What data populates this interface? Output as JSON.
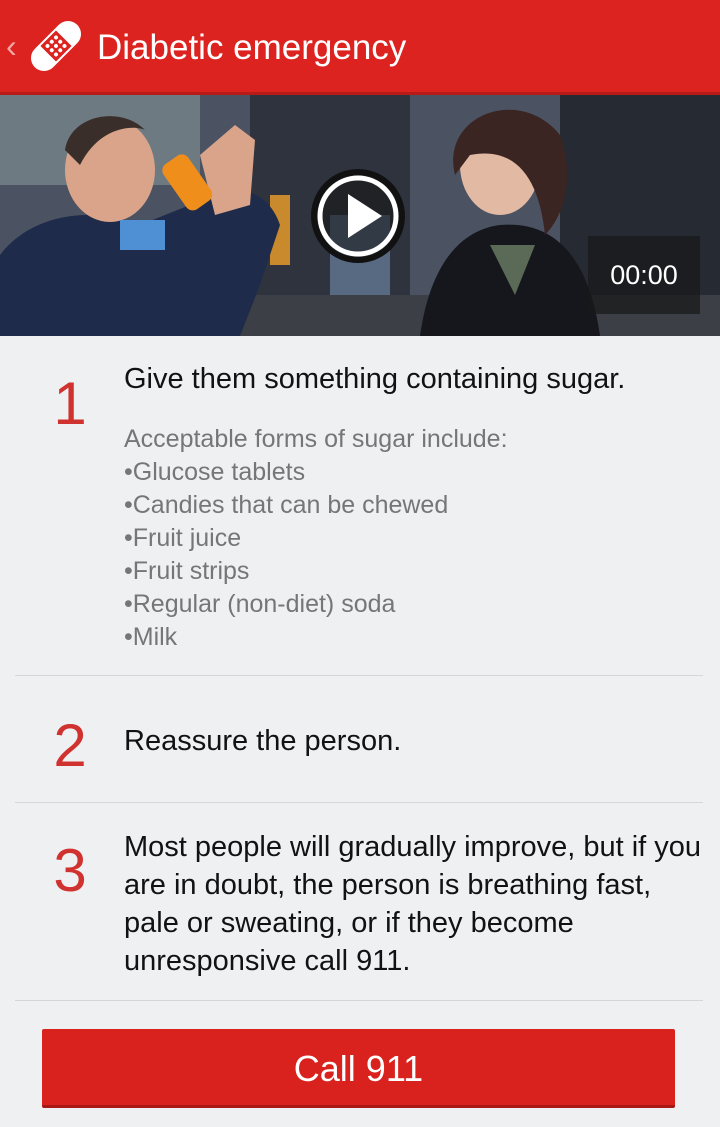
{
  "header": {
    "back_icon": "chevron-left-icon",
    "app_icon": "bandage-icon",
    "title": "Diabetic emergency",
    "background_color": "#dc231f"
  },
  "video": {
    "play_icon": "play-icon",
    "timestamp": "00:00"
  },
  "steps": [
    {
      "number": "1",
      "heading": "Give them something containing sugar.",
      "detail": [
        "Acceptable forms of sugar include:",
        "•Glucose tablets",
        "•Candies that can be chewed",
        "•Fruit juice",
        "•Fruit strips",
        "•Regular (non-diet) soda",
        "•Milk"
      ]
    },
    {
      "number": "2",
      "heading": "Reassure the person."
    },
    {
      "number": "3",
      "heading": "Most people will gradually improve, but if you are in doubt, the person is breathing fast, pale or sweating, or if they become unresponsive call 911."
    }
  ],
  "call_button": {
    "label": "Call 911",
    "color": "#d9211d"
  }
}
